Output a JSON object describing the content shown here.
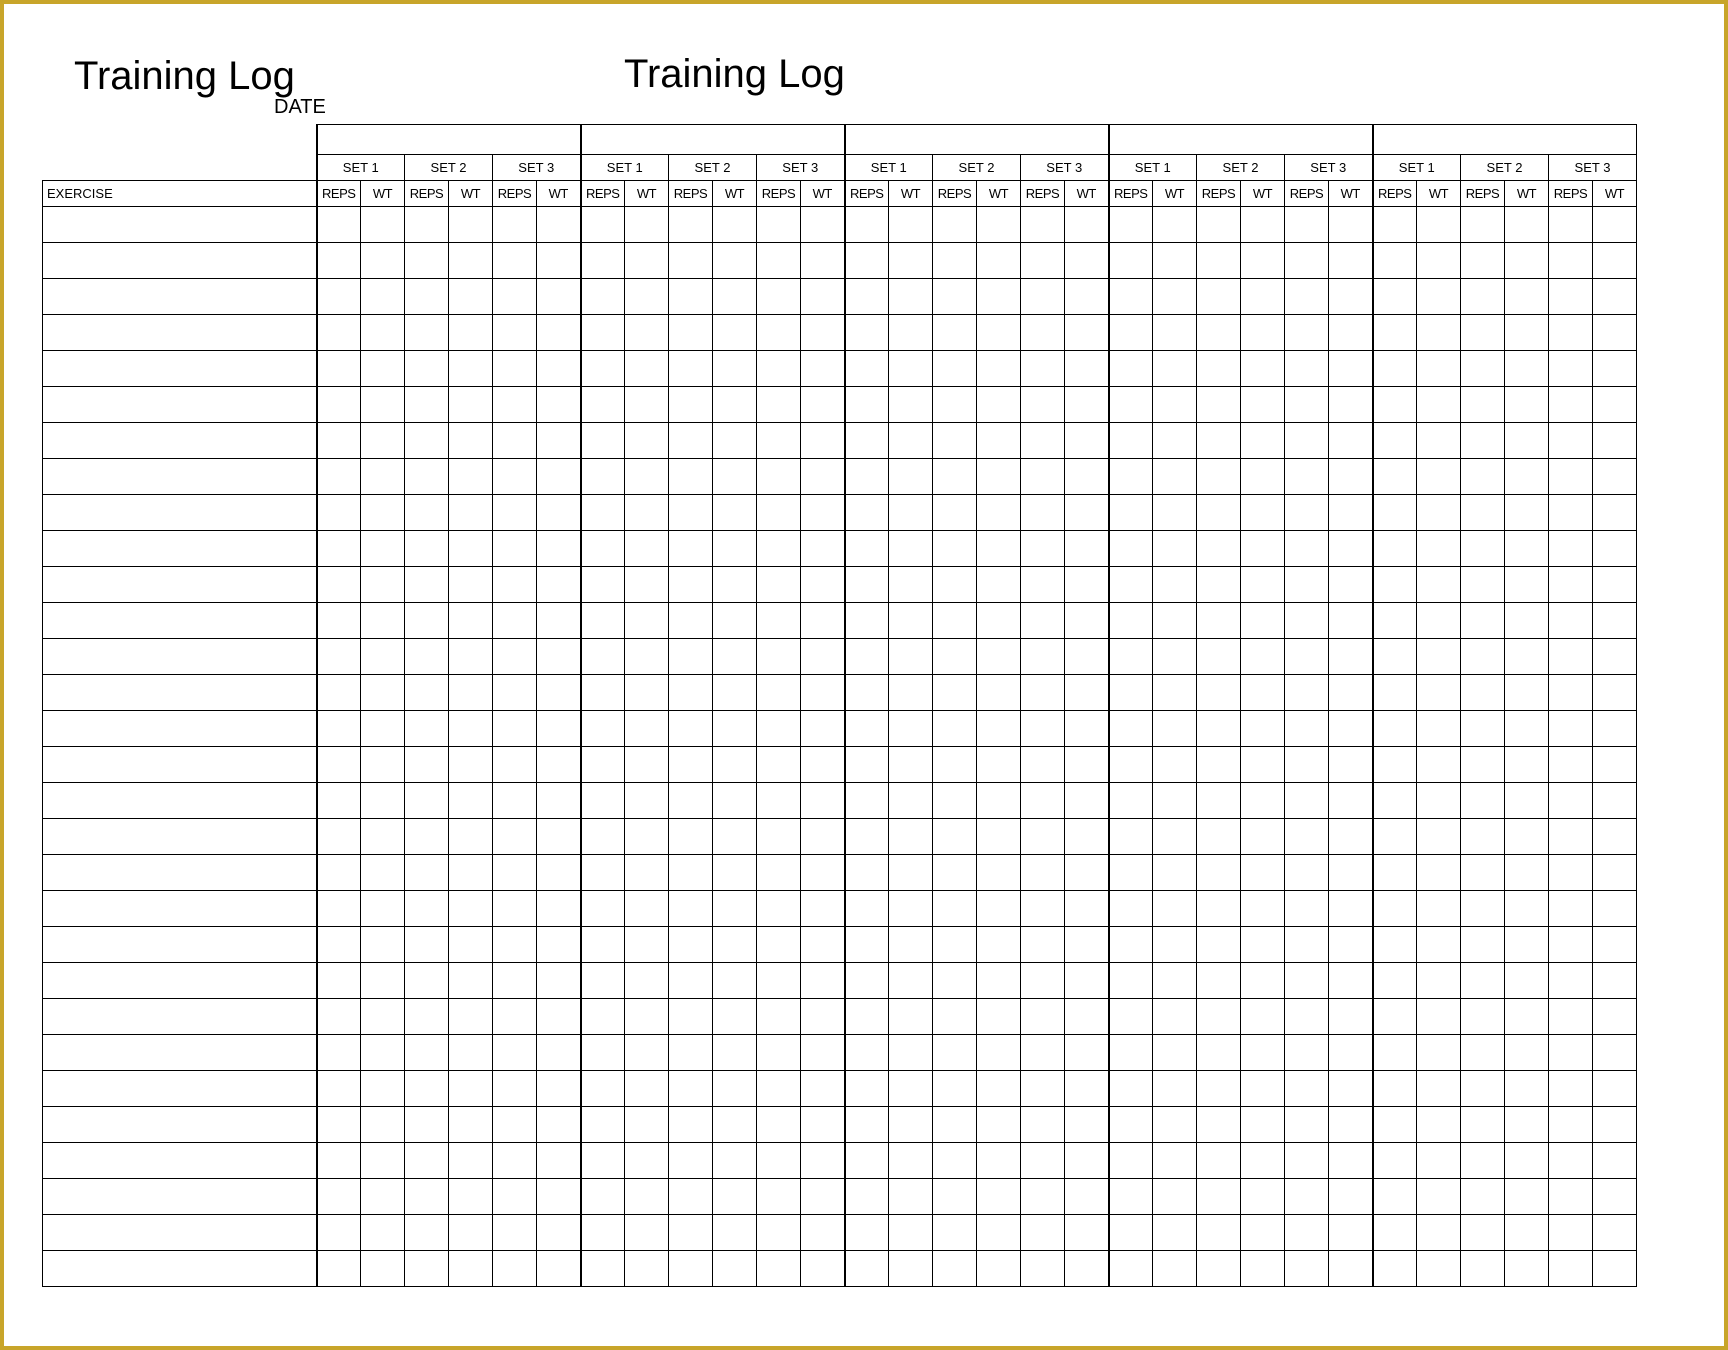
{
  "titles": {
    "left": "Training Log",
    "center": "Training Log"
  },
  "labels": {
    "date": "DATE",
    "exercise": "EXERCISE"
  },
  "days": 5,
  "sets_per_day": 3,
  "set_labels": [
    "SET 1",
    "SET 2",
    "SET 3"
  ],
  "col_labels": {
    "reps": "REPS",
    "wt": "WT"
  },
  "exercise_rows": 30
}
